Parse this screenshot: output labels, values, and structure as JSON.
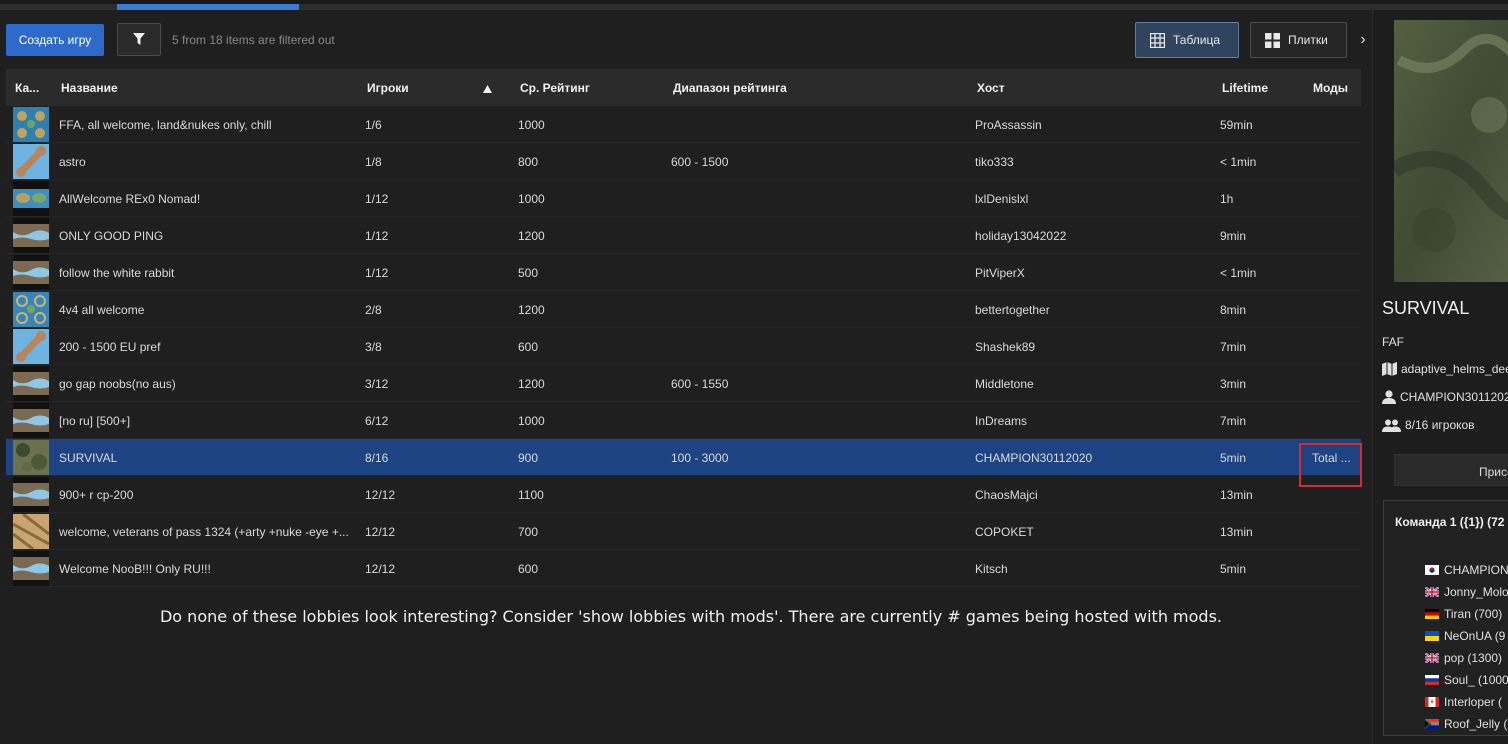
{
  "toolbar": {
    "create_label": "Создать игру",
    "filter_status": "5 from 18 items are filtered out",
    "view_table_label": "Таблица",
    "view_tiles_label": "Плитки",
    "more_icon": "chevron-right-icon"
  },
  "table": {
    "columns": {
      "map": "Ка...",
      "name": "Название",
      "players": "Игроки",
      "avg_rating": "Ср. Рейтинг",
      "rating_range": "Диапазон рейтинга",
      "host": "Хост",
      "lifetime": "Lifetime",
      "mods": "Моды"
    },
    "sort": {
      "column": "players",
      "direction": "ascending",
      "icon": "sort-up-icon"
    },
    "rows": [
      {
        "name": "FFA, all welcome, land&nukes only, chill",
        "players": "1/6",
        "rating": "1000",
        "range": "",
        "host": "ProAssassin",
        "lifetime": "59min",
        "mods": "",
        "thumb": "islands"
      },
      {
        "name": "astro",
        "players": "1/8",
        "rating": "800",
        "range": "600 - 1500",
        "host": "tiko333",
        "lifetime": "< 1min",
        "mods": "",
        "thumb": "bone"
      },
      {
        "name": "AllWelcome REx0 Nomad!",
        "players": "1/12",
        "rating": "1000",
        "range": "",
        "host": "lxlDenislxl",
        "lifetime": "1h",
        "mods": "",
        "thumb": "islands-wide"
      },
      {
        "name": "ONLY GOOD PING",
        "players": "1/12",
        "rating": "1200",
        "range": "",
        "host": "holiday13042022",
        "lifetime": "9min",
        "mods": "",
        "thumb": "river"
      },
      {
        "name": "follow the white rabbit",
        "players": "1/12",
        "rating": "500",
        "range": "",
        "host": "PitViperX",
        "lifetime": "< 1min",
        "mods": "",
        "thumb": "river"
      },
      {
        "name": "4v4 all welcome",
        "players": "2/8",
        "rating": "1200",
        "range": "",
        "host": "bettertogether",
        "lifetime": "8min",
        "mods": "",
        "thumb": "rings"
      },
      {
        "name": "200 - 1500 EU pref",
        "players": "3/8",
        "rating": "600",
        "range": "",
        "host": "Shashek89",
        "lifetime": "7min",
        "mods": "",
        "thumb": "bone"
      },
      {
        "name": "go gap noobs(no aus)",
        "players": "3/12",
        "rating": "1200",
        "range": "600 - 1550",
        "host": "Middletone",
        "lifetime": "3min",
        "mods": "",
        "thumb": "river"
      },
      {
        "name": "[no ru] [500+]",
        "players": "6/12",
        "rating": "1000",
        "range": "",
        "host": "InDreams",
        "lifetime": "7min",
        "mods": "",
        "thumb": "river"
      },
      {
        "name": "SURVIVAL",
        "players": "8/16",
        "rating": "900",
        "range": "100 - 3000",
        "host": "CHAMPION30112020",
        "lifetime": "5min",
        "mods": "Total ...",
        "thumb": "forest",
        "selected": true
      },
      {
        "name": "900+ r cp-200",
        "players": "12/12",
        "rating": "1100",
        "range": "",
        "host": "ChaosMajci",
        "lifetime": "13min",
        "mods": "",
        "thumb": "river"
      },
      {
        "name": "welcome, veterans of pass 1324 (+arty +nuke -eye +...",
        "players": "12/12",
        "rating": "700",
        "range": "",
        "host": "COPOKET",
        "lifetime": "13min",
        "mods": "",
        "thumb": "desert"
      },
      {
        "name": "Welcome NooB!!! Only RU!!!",
        "players": "12/12",
        "rating": "600",
        "range": "",
        "host": "Kitsch",
        "lifetime": "5min",
        "mods": "",
        "thumb": "river"
      }
    ]
  },
  "footer_note": "Do none of these lobbies look interesting? Consider 'show lobbies with mods'. There are currently # games being hosted with mods.",
  "side": {
    "title": "SURVIVAL",
    "featured_mod": "FAF",
    "map_name": "adaptive_helms_dee",
    "host": "CHAMPION3011202",
    "players_label": "8/16 игроков",
    "join_label": "Присо",
    "team_title": "Команда 1 ({1}) (72",
    "players": [
      {
        "name": "CHAMPION",
        "flag": "kr"
      },
      {
        "name": "Jonny_Molo",
        "flag": "gb"
      },
      {
        "name": "Tiran  (700)",
        "flag": "de"
      },
      {
        "name": "NeOnUA  (9",
        "flag": "ua"
      },
      {
        "name": "pop  (1300)",
        "flag": "gb"
      },
      {
        "name": "Soul_  (1000",
        "flag": "ru"
      },
      {
        "name": "Interloper  (",
        "flag": "ca"
      },
      {
        "name": "Roof_Jelly  (",
        "flag": "za"
      }
    ]
  },
  "colors": {
    "accent": "#2d6ac9",
    "selected_row": "#1e4383",
    "highlight_box": "#d22c34"
  }
}
